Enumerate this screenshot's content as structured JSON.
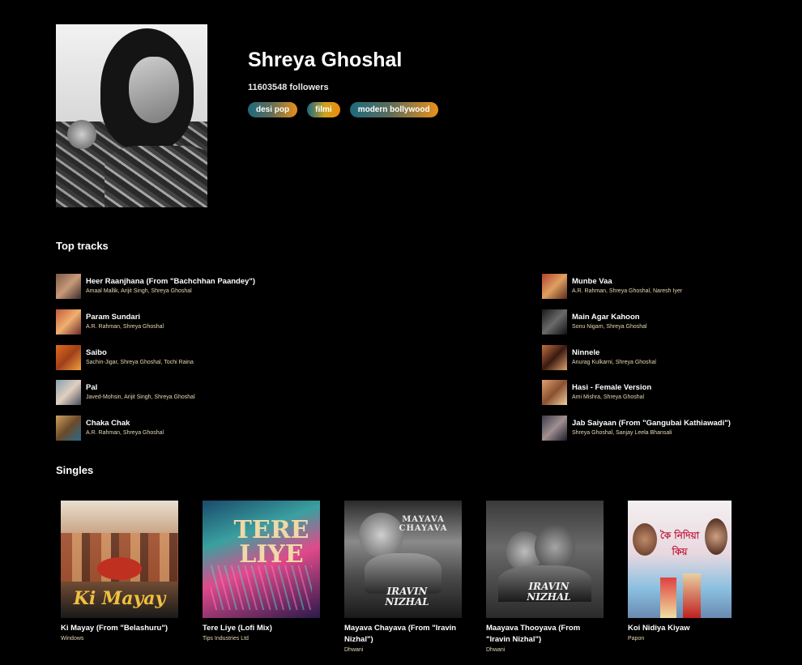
{
  "artist": {
    "name": "Shreya Ghoshal",
    "followers": "11603548 followers",
    "genres": [
      "desi pop",
      "filmi",
      "modern bollywood"
    ]
  },
  "top_tracks": {
    "heading": "Top tracks",
    "items": [
      {
        "title": "Heer Raanjhana (From \"Bachchhan Paandey\")",
        "artists": "Amaal Mallik, Arijit Singh, Shreya Ghoshal"
      },
      {
        "title": "Param Sundari",
        "artists": "A.R. Rahman, Shreya Ghoshal"
      },
      {
        "title": "Saibo",
        "artists": "Sachin-Jigar, Shreya Ghoshal, Tochi Raina"
      },
      {
        "title": "Pal",
        "artists": "Javed-Mohsin, Arijit Singh, Shreya Ghoshal"
      },
      {
        "title": "Chaka Chak",
        "artists": "A.R. Rahman, Shreya Ghoshal"
      },
      {
        "title": "Munbe Vaa",
        "artists": "A.R. Rahman, Shreya Ghoshal, Naresh Iyer"
      },
      {
        "title": "Main Agar Kahoon",
        "artists": "Sonu Nigam, Shreya Ghoshal"
      },
      {
        "title": "Ninnele",
        "artists": "Anurag Kulkarni, Shreya Ghoshal"
      },
      {
        "title": "Hasi - Female Version",
        "artists": "Ami Mishra, Shreya Ghoshal"
      },
      {
        "title": "Jab Saiyaan (From \"Gangubai Kathiawadi\")",
        "artists": "Shreya Ghoshal, Sanjay Leela Bhansali"
      }
    ]
  },
  "singles": {
    "heading": "Singles",
    "items": [
      {
        "title": "Ki Mayay (From \"Belashuru\")",
        "label": "Windows",
        "cover_text": "Ki Mayay"
      },
      {
        "title": "Tere Liye (Lofi Mix)",
        "label": "Tips Industries Ltd",
        "cover_text": "TERE LIYE"
      },
      {
        "title": "Mayava Chayava (From \"Iravin Nizhal\")",
        "label": "Dhwani",
        "cover_text": "IRAVIN NIZHAL",
        "cover_subtext": "MAYAVA CHAYAVA"
      },
      {
        "title": "Maayava Thooyava (From \"Iravin Nizhal\")",
        "label": "Dhwani",
        "cover_text": "IRAVIN NIZHAL"
      },
      {
        "title": "Koi Nidiya Kiyaw",
        "label": "Papon",
        "cover_text": "কৈ নিদিয়া কিয়"
      }
    ]
  },
  "colors": {
    "background": "#000000",
    "text": "#ffffff",
    "subtext": "#e6d8b4",
    "pill_start": "#1d6a7f",
    "pill_end": "#e8901a"
  }
}
